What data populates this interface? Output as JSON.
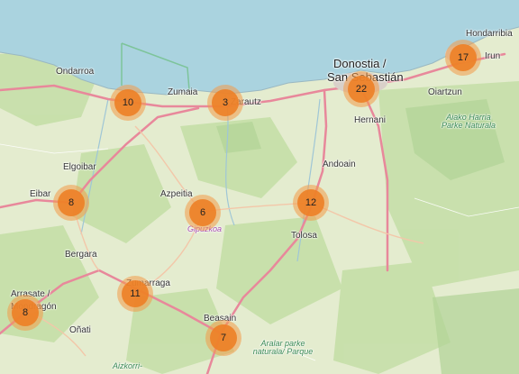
{
  "map": {
    "place_labels": [
      {
        "id": "hondarribia",
        "text": "Hondarribia"
      },
      {
        "id": "irun",
        "text": "Irun"
      },
      {
        "id": "donostia1",
        "text": "Donostia /"
      },
      {
        "id": "donostia2",
        "text": "San Sebastián"
      },
      {
        "id": "oiartzun",
        "text": "Oiartzun"
      },
      {
        "id": "ondarroa",
        "text": "Ondarroa"
      },
      {
        "id": "zumaia",
        "text": "Zumaia"
      },
      {
        "id": "zarautz",
        "text": "Zarautz"
      },
      {
        "id": "hernani",
        "text": "Hernani"
      },
      {
        "id": "andoain",
        "text": "Andoain"
      },
      {
        "id": "elgoibar",
        "text": "Elgoibar"
      },
      {
        "id": "eibar",
        "text": "Eibar"
      },
      {
        "id": "azpeitia",
        "text": "Azpeitia"
      },
      {
        "id": "tolosa",
        "text": "Tolosa"
      },
      {
        "id": "bergara",
        "text": "Bergara"
      },
      {
        "id": "arrasate1",
        "text": "Arrasate /"
      },
      {
        "id": "arrasate2",
        "text": "Mondragón"
      },
      {
        "id": "zumarraga",
        "text": "Zumarraga"
      },
      {
        "id": "onati",
        "text": "Oñati"
      },
      {
        "id": "beasain",
        "text": "Beasain"
      },
      {
        "id": "aizkorri",
        "text": "Aizkorri-"
      }
    ],
    "province_label": "Gipuzkoa",
    "park_labels": [
      {
        "id": "aiako",
        "text": "Aiako Harria Parke Naturala"
      },
      {
        "id": "aralar",
        "text": "Aralar parke naturala/ Parque"
      }
    ],
    "clusters": [
      {
        "id": "irun-cluster",
        "count": "17"
      },
      {
        "id": "donostia-cluster",
        "count": "22"
      },
      {
        "id": "ondarroa-cluster",
        "count": "10"
      },
      {
        "id": "zarautz-cluster",
        "count": "3"
      },
      {
        "id": "eibar-cluster",
        "count": "8"
      },
      {
        "id": "azpeitia-cluster",
        "count": "6"
      },
      {
        "id": "tolosa-cluster",
        "count": "12"
      },
      {
        "id": "zumarraga-cluster",
        "count": "11"
      },
      {
        "id": "arrasate-cluster",
        "count": "8"
      },
      {
        "id": "beasain-cluster",
        "count": "7"
      }
    ],
    "colors": {
      "sea": "#aad3df",
      "land": "#e4eccf",
      "forest": "#c4dea6",
      "road": "#e8889b",
      "park": "#6fbf8a",
      "cluster": "#ed8026"
    }
  }
}
